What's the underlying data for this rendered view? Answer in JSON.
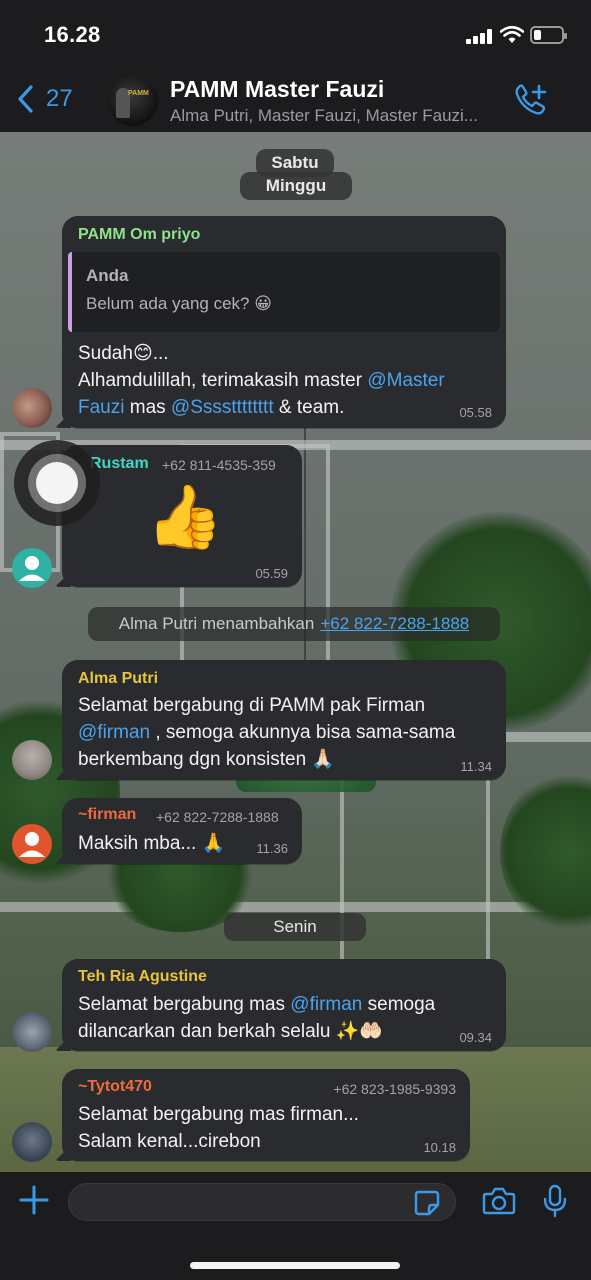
{
  "status_bar": {
    "time": "16.28",
    "battery_level": 0.25
  },
  "header": {
    "back_count": "27",
    "title": "PAMM Master Fauzi",
    "subtitle": "Alma Putri, Master Fauzi, Master Fauzi...",
    "avatar_text": "PAMM",
    "icons": {
      "back": "chevron-left-icon",
      "call": "phone-add-icon"
    }
  },
  "dates": {
    "sabtu": "Sabtu",
    "minggu": "Minggu",
    "senin": "Senin"
  },
  "messages": [
    {
      "sender": "PAMM Om priyo",
      "sender_color": "#8fe38a",
      "quote": {
        "name": "Anda",
        "text": "Belum ada yang cek? 😀"
      },
      "line1": "Sudah😊...",
      "line2_pre": "Alhamdulillah, terimakasih master ",
      "mention1": "@Master",
      "mention1b": "Fauzi",
      "line3_mid": " mas ",
      "mention2": "@Sssstttttttt",
      "line3_post": " & team.",
      "time": "05.58"
    },
    {
      "sender": "Rustam",
      "sender_color": "#3fd7c9",
      "phone": "+62 811-4535-359",
      "emoji": "👍",
      "time": "05.59"
    },
    {
      "sender": "Alma Putri",
      "sender_color": "#e8c43a",
      "line1": "Selamat bergabung di PAMM pak Firman",
      "mention": "@firman",
      "line2_post": " , semoga akunnya bisa sama-sama",
      "line3": "berkembang dgn konsisten 🙏🏻",
      "time": "11.34"
    },
    {
      "sender": "~firman",
      "sender_color": "#f06a3c",
      "phone": "+62 822-7288-1888",
      "text": "Maksih mba... 🙏",
      "time": "11.36"
    },
    {
      "sender": "Teh Ria Agustine",
      "sender_color": "#e8c43a",
      "line1_pre": "Selamat bergabung mas ",
      "mention": "@firman",
      "line1_post": " semoga",
      "line2": "dilancarkan dan berkah selalu ✨🤲🏻",
      "time": "09.34"
    },
    {
      "sender": "~Tytot470",
      "sender_color": "#f06a3c",
      "phone": "+62 823-1985-9393",
      "line1": "Selamat bergabung mas firman...",
      "line2": "Salam kenal...cirebon",
      "time": "10.18"
    }
  ],
  "system": {
    "text": "Alma Putri menambahkan",
    "link": "+62 822-7288-1888"
  },
  "input": {
    "placeholder": ""
  },
  "colors": {
    "accent": "#3b9ae8",
    "bubble": "#2a2b2e",
    "mention": "#4aa3ee"
  }
}
